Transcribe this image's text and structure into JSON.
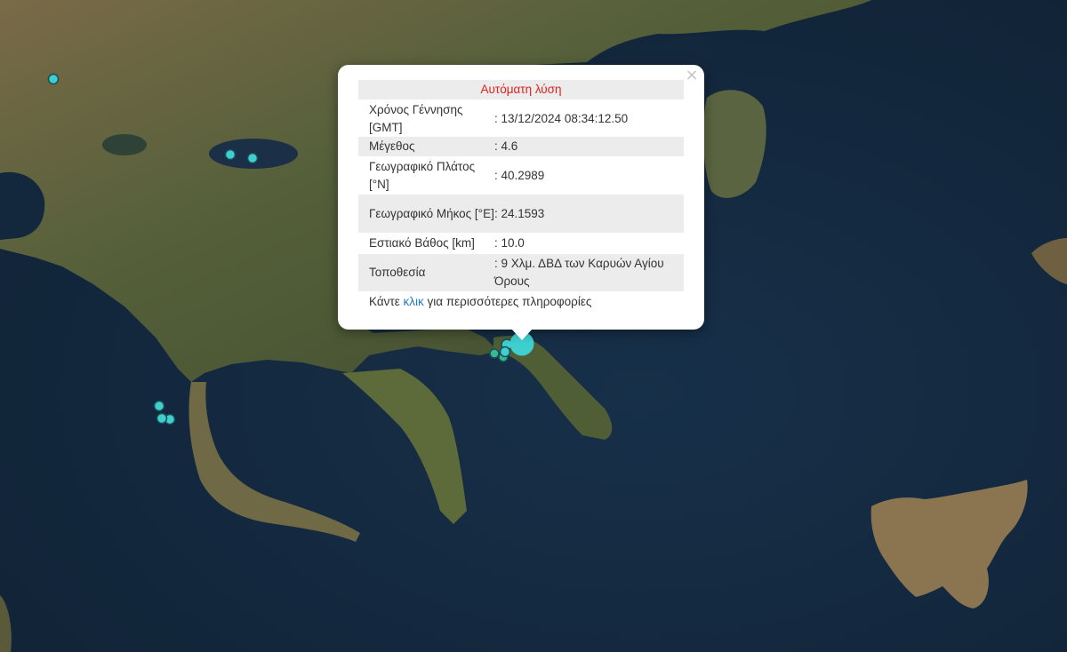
{
  "popup": {
    "header": "Αυτόματη λύση",
    "close_symbol": "×",
    "rows": [
      {
        "label": "Χρόνος Γέννησης [GMT]",
        "value": ": 13/12/2024 08:34:12.50"
      },
      {
        "label": "Μέγεθος",
        "value": ": 4.6"
      },
      {
        "label": "Γεωγραφικό Πλάτος [°N]",
        "value": ": 40.2989"
      },
      {
        "label": "Γεωγραφικό Μήκος [°E]",
        "value": ": 24.1593"
      },
      {
        "label": "Εστιακό Βάθος [km]",
        "value": ": 10.0"
      },
      {
        "label": "Τοποθεσία",
        "value": ": 9 Χλμ. ΔΒΔ των Καρυών Αγίου Όρους"
      }
    ],
    "footer_prefix": "Κάντε",
    "footer_link": "κλικ",
    "footer_suffix": "για περισσότερες πληροφορίες"
  },
  "colors": {
    "sea": "#13263b",
    "land": "#4b5530",
    "land_light": "#8b7b55",
    "marker_fill": "#3fcfcf",
    "marker_stroke": "#1b4b57",
    "marker_green": "#36b890",
    "header_text": "#e0211d",
    "link": "#2779c9"
  },
  "icons": {
    "close": "close-icon",
    "earthquake_marker": "earthquake-marker-icon"
  }
}
